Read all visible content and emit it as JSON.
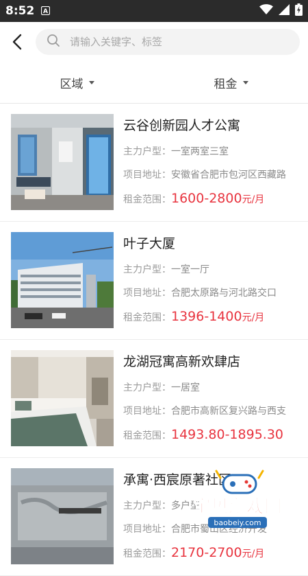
{
  "status_bar": {
    "time": "8:52",
    "app_badge": "A"
  },
  "search": {
    "placeholder": "请输入关键字、标签"
  },
  "filters": {
    "region": "区域",
    "rent": "租金"
  },
  "labels": {
    "layout": "主力户型：",
    "address": "项目地址：",
    "rent": "租金范围："
  },
  "listings": [
    {
      "title": "云谷创新园人才公寓",
      "layout": "一室两室三室",
      "address": "安徽省合肥市包河区西藏路",
      "price": "1600-2800",
      "unit": "元/月"
    },
    {
      "title": "叶子大厦",
      "layout": "一室一厅",
      "address": "合肥太原路与河北路交口",
      "price": "1396-1400",
      "unit": "元/月"
    },
    {
      "title": "龙湖冠寓高新欢肆店",
      "layout": "一居室",
      "address": "合肥市高新区复兴路与西支",
      "price": "1493.80-1895.30",
      "unit": ""
    },
    {
      "title": "承寓·西宸原著社区",
      "layout": "多户型",
      "address": "合肥市蜀山区经济开发",
      "price": "2170-2700",
      "unit": "元/月"
    }
  ],
  "watermark": {
    "main": "宝贝游戏网",
    "sub": "baobeiy.com"
  },
  "colors": {
    "price": "#e8343f",
    "status_bar": "#2b2b2b",
    "search_bg": "#f3f3f3"
  }
}
